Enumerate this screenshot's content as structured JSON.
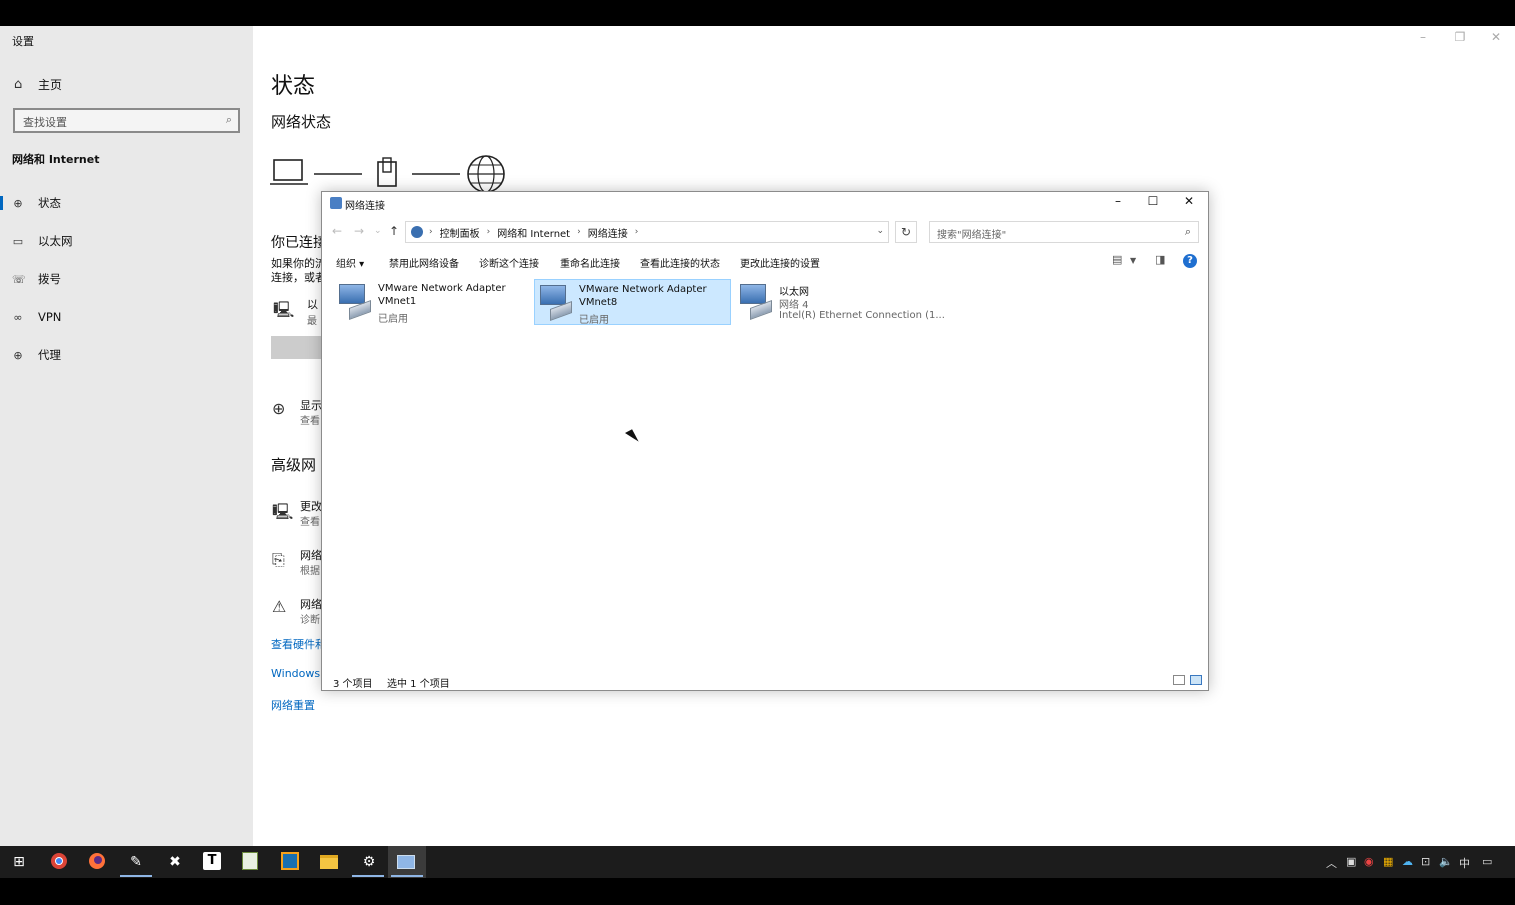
{
  "settings": {
    "title": "设置",
    "home_label": "主页",
    "search_placeholder": "查找设置",
    "section": "网络和 Internet",
    "nav": [
      {
        "label": "状态",
        "icon": "status-icon"
      },
      {
        "label": "以太网",
        "icon": "ethernet-icon"
      },
      {
        "label": "拨号",
        "icon": "dialup-icon"
      },
      {
        "label": "VPN",
        "icon": "vpn-icon"
      },
      {
        "label": "代理",
        "icon": "proxy-icon"
      }
    ],
    "main": {
      "title": "状态",
      "subtitle": "网络状态",
      "connected_heading": "你已连接",
      "desc_line1": "如果你的流",
      "desc_line2": "连接，或者",
      "conn_name": "以",
      "conn_sub": "最",
      "show_label": "显示",
      "show_sub": "查看",
      "advanced_heading": "高级网",
      "adv1": "更改",
      "adv1_sub": "查看",
      "adv2": "网络",
      "adv2_sub": "根据",
      "adv3": "网络",
      "adv3_sub": "诊断",
      "link_hardware": "查看硬件和",
      "link_windows": "Windows",
      "link_reset": "网络重置"
    }
  },
  "network_window": {
    "title": "网络连接",
    "breadcrumb": [
      "控制面板",
      "网络和 Internet",
      "网络连接"
    ],
    "search_placeholder": "搜索\"网络连接\"",
    "toolbar": [
      "组织 ▾",
      "禁用此网络设备",
      "诊断这个连接",
      "重命名此连接",
      "查看此连接的状态",
      "更改此连接的设置"
    ],
    "items": [
      {
        "line1": "VMware Network Adapter",
        "line2": "VMnet1",
        "line3": "已启用",
        "selected": false
      },
      {
        "line1": "VMware Network Adapter",
        "line2": "VMnet8",
        "line3": "已启用",
        "selected": true
      },
      {
        "line1": "以太网",
        "line2": "网络 4",
        "line3": "Intel(R) Ethernet Connection (1...",
        "selected": false
      }
    ],
    "status_count": "3 个项目",
    "status_selected": "选中 1 个项目"
  },
  "tray": {
    "ime": "中"
  }
}
